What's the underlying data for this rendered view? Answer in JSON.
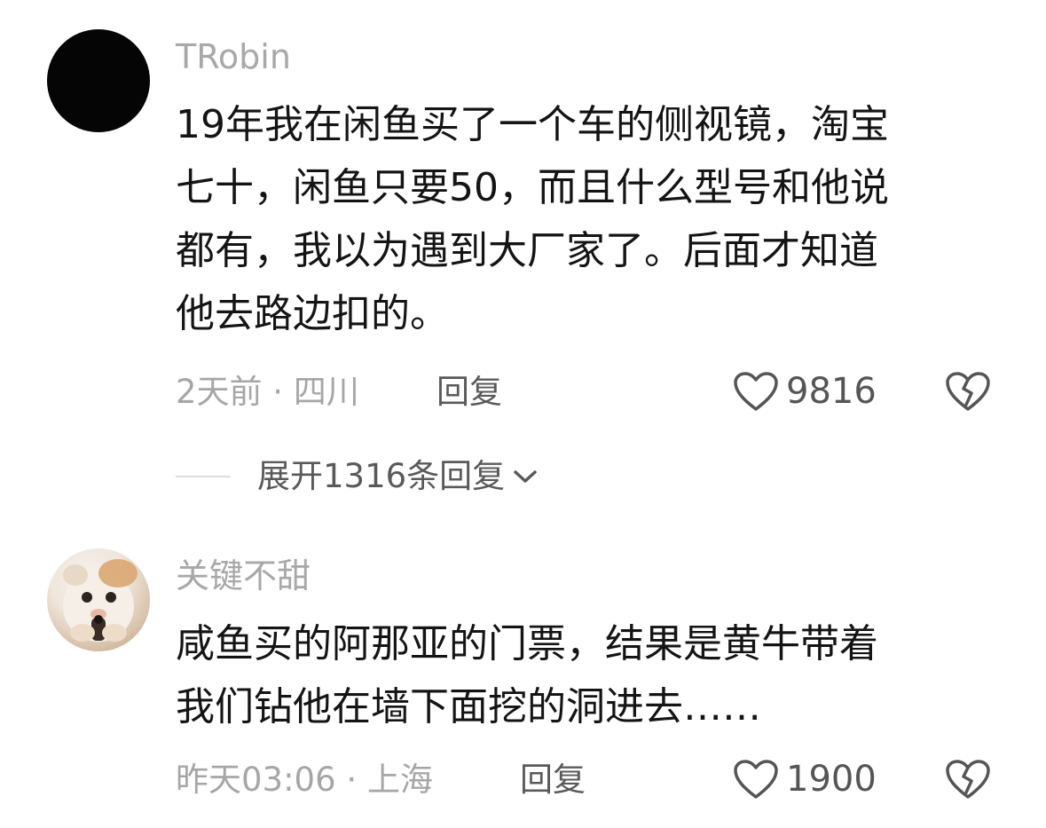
{
  "comments": [
    {
      "username": "TRobin",
      "avatar_icon": "black-circle-avatar",
      "text_lines": [
        "19年我在闲鱼买了一个车的侧视镜，淘宝",
        "七十，闲鱼只要50，而且什么型号和他说",
        "都有，我以为遇到大厂家了。后面才知道",
        "他去路边扣的。"
      ],
      "meta": "2天前 · 四川",
      "reply_label": "回复",
      "likes": "9816",
      "expand_label": "展开1316条回复"
    },
    {
      "username": "关键不甜",
      "avatar_icon": "cat-photo-avatar",
      "text_lines": [
        "咸鱼买的阿那亚的门票，结果是黄牛带着",
        "我们钻他在墙下面挖的洞进去……"
      ],
      "meta": "昨天03:06 · 上海",
      "reply_label": "回复",
      "likes": "1900"
    }
  ],
  "colors": {
    "background": "#ffffff",
    "text_primary": "#141414",
    "text_secondary": "#a6a6a6",
    "action_text": "#5a5a5a"
  }
}
